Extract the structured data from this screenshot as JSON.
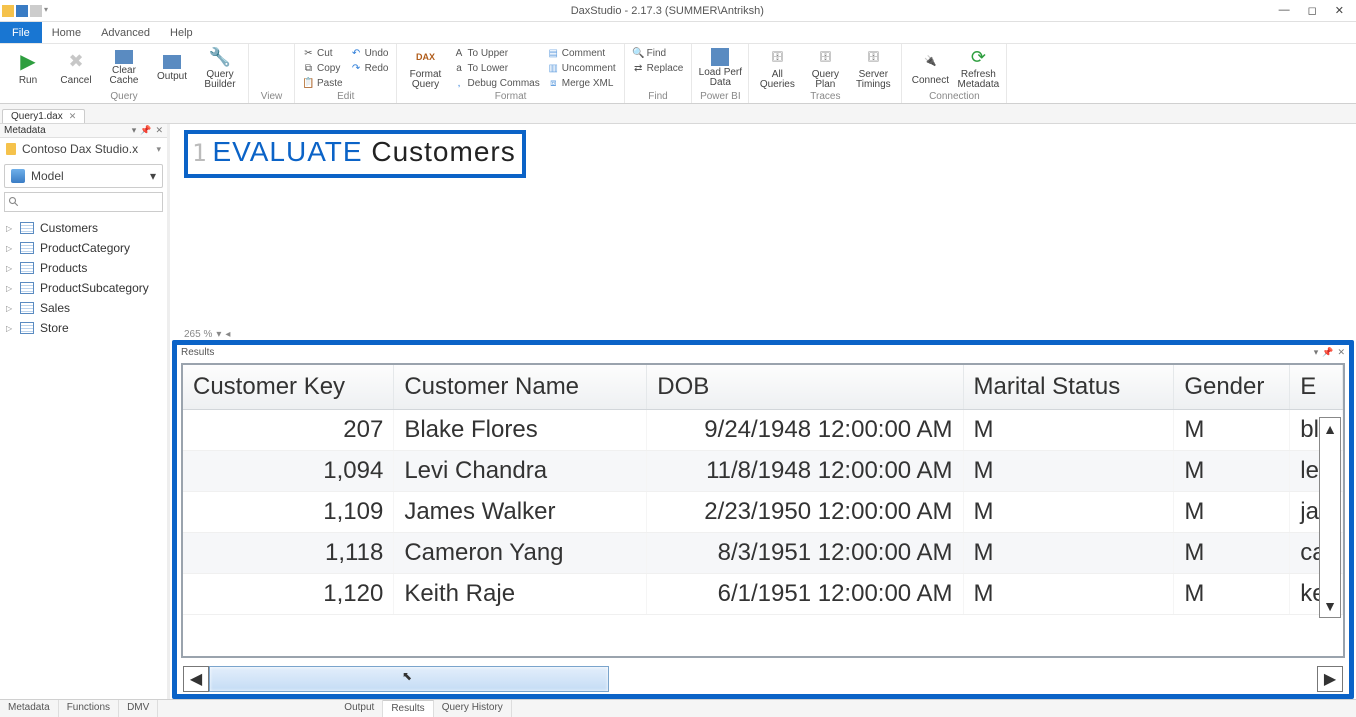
{
  "titlebar": {
    "app_title": "DaxStudio - 2.17.3 (SUMMER\\Antriksh)"
  },
  "menubar": {
    "file": "File",
    "home": "Home",
    "advanced": "Advanced",
    "help": "Help"
  },
  "ribbon": {
    "run": "Run",
    "cancel": "Cancel",
    "clear_cache": "Clear\nCache",
    "output": "Output",
    "query_builder": "Query\nBuilder",
    "group_query": "Query",
    "group_view": "View",
    "cut": "Cut",
    "copy": "Copy",
    "paste": "Paste",
    "undo": "Undo",
    "redo": "Redo",
    "group_edit": "Edit",
    "format_query": "Format\nQuery",
    "to_upper": "To Upper",
    "to_lower": "To Lower",
    "debug_commas": "Debug Commas",
    "comment": "Comment",
    "uncomment": "Uncomment",
    "merge_xml": "Merge XML",
    "group_format": "Format",
    "find": "Find",
    "replace": "Replace",
    "group_find": "Find",
    "load_perf": "Load Perf\nData",
    "group_powerbi": "Power BI",
    "all_queries": "All\nQueries",
    "query_plan": "Query\nPlan",
    "server_timings": "Server\nTimings",
    "group_traces": "Traces",
    "connect": "Connect",
    "refresh_meta": "Refresh\nMetadata",
    "group_connection": "Connection"
  },
  "doctab": {
    "name": "Query1.dax",
    "close": "✕"
  },
  "sidebar": {
    "panel_title": "Metadata",
    "db_name": "Contoso Dax Studio.x",
    "model": "Model",
    "tables": [
      "Customers",
      "ProductCategory",
      "Products",
      "ProductSubcategory",
      "Sales",
      "Store"
    ]
  },
  "editor": {
    "line_no": "1",
    "keyword": "EVALUATE",
    "identifier": " Customers",
    "zoom": "265 %"
  },
  "results": {
    "title": "Results",
    "columns": [
      "Customer Key",
      "Customer Name",
      "DOB",
      "Marital Status",
      "Gender",
      "E"
    ],
    "rows": [
      {
        "key": "207",
        "name": "Blake Flores",
        "dob": "9/24/1948 12:00:00 AM",
        "ms": "M",
        "g": "M",
        "e": "bla"
      },
      {
        "key": "1,094",
        "name": "Levi Chandra",
        "dob": "11/8/1948 12:00:00 AM",
        "ms": "M",
        "g": "M",
        "e": "lev"
      },
      {
        "key": "1,109",
        "name": "James Walker",
        "dob": "2/23/1950 12:00:00 AM",
        "ms": "M",
        "g": "M",
        "e": "jai"
      },
      {
        "key": "1,118",
        "name": "Cameron Yang",
        "dob": "8/3/1951 12:00:00 AM",
        "ms": "M",
        "g": "M",
        "e": "ca"
      },
      {
        "key": "1,120",
        "name": "Keith Raje",
        "dob": "6/1/1951 12:00:00 AM",
        "ms": "M",
        "g": "M",
        "e": "ke"
      }
    ]
  },
  "bottom_tabs": {
    "left": [
      "Metadata",
      "Functions",
      "DMV"
    ],
    "right": [
      "Output",
      "Results",
      "Query History"
    ],
    "active_right": "Results"
  }
}
